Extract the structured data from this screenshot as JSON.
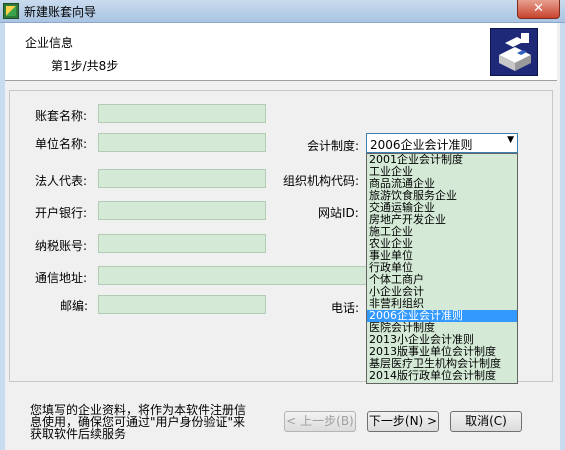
{
  "window": {
    "title": "新建账套向导",
    "close_label": "✕"
  },
  "header": {
    "title": "企业信息",
    "step": "第1步/共8步"
  },
  "form": {
    "account_name_label": "账套名称:",
    "unit_name_label": "单位名称:",
    "legal_rep_label": "法人代表:",
    "bank_label": "开户银行:",
    "tax_no_label": "纳税账号:",
    "address_label": "通信地址:",
    "postcode_label": "邮编:",
    "accounting_system_label": "会计制度:",
    "org_code_label": "组织机构代码:",
    "website_label": "网站ID:",
    "phone_label": "电话:"
  },
  "accounting_system": {
    "selected": "2006企业会计准则",
    "options": [
      "2001企业会计制度",
      "工业企业",
      "商品流通企业",
      "旅游饮食服务企业",
      "交通运输企业",
      "房地产开发企业",
      "施工企业",
      "农业企业",
      "事业单位",
      "行政单位",
      "个体工商户",
      "小企业会计",
      "非营利组织",
      "2006企业会计准则",
      "医院会计制度",
      "2013小企业会计准则",
      "2013版事业单位会计制度",
      "基层医疗卫生机构会计制度",
      "2014版行政单位会计制度"
    ]
  },
  "footer": {
    "note": "您填写的企业资料，将作为本软件注册信息使用，确保您可通过\"用户身份验证\"来获取软件后续服务",
    "prev_label": "< 上一步(B)",
    "next_label": "下一步(N) >",
    "cancel_label": "取消(C)"
  }
}
